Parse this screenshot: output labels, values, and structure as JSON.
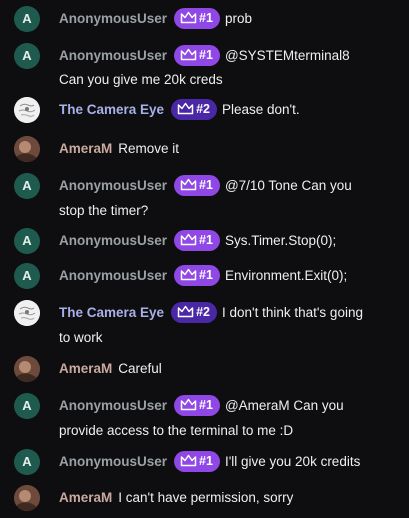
{
  "colors": {
    "background": "#0e0e10",
    "badge_rank1": "#8f47e5",
    "badge_rank2": "#4a27a6"
  },
  "messages": [
    {
      "user": "AnonymousUser",
      "avatar_letter": "A",
      "badge": "#1",
      "text": "prob",
      "cont": ""
    },
    {
      "user": "AnonymousUser",
      "avatar_letter": "A",
      "badge": "#1",
      "text": "@SYSTEMterminal8",
      "cont": "Can you give me 20k creds"
    },
    {
      "user": "The Camera Eye",
      "badge": "#2",
      "text": "Please don't.",
      "cont": ""
    },
    {
      "user": "AmeraM",
      "text": "Remove it",
      "cont": ""
    },
    {
      "user": "AnonymousUser",
      "avatar_letter": "A",
      "badge": "#1",
      "text": "@7/10 Tone Can you",
      "cont": "stop the timer?"
    },
    {
      "user": "AnonymousUser",
      "avatar_letter": "A",
      "badge": "#1",
      "text": "Sys.Timer.Stop(0);",
      "cont": ""
    },
    {
      "user": "AnonymousUser",
      "avatar_letter": "A",
      "badge": "#1",
      "text": "Environment.Exit(0);",
      "cont": ""
    },
    {
      "user": "The Camera Eye",
      "badge": "#2",
      "text": "I don't think that's going",
      "cont": "to work"
    },
    {
      "user": "AmeraM",
      "text": "Careful",
      "cont": ""
    },
    {
      "user": "AnonymousUser",
      "avatar_letter": "A",
      "badge": "#1",
      "text": "@AmeraM Can you",
      "cont": "provide access to the terminal to me :D"
    },
    {
      "user": "AnonymousUser",
      "avatar_letter": "A",
      "badge": "#1",
      "text": "I'll give you 20k credits",
      "cont": ""
    },
    {
      "user": "AmeraM",
      "text": "I can't have permission, sorry",
      "cont": ""
    }
  ]
}
